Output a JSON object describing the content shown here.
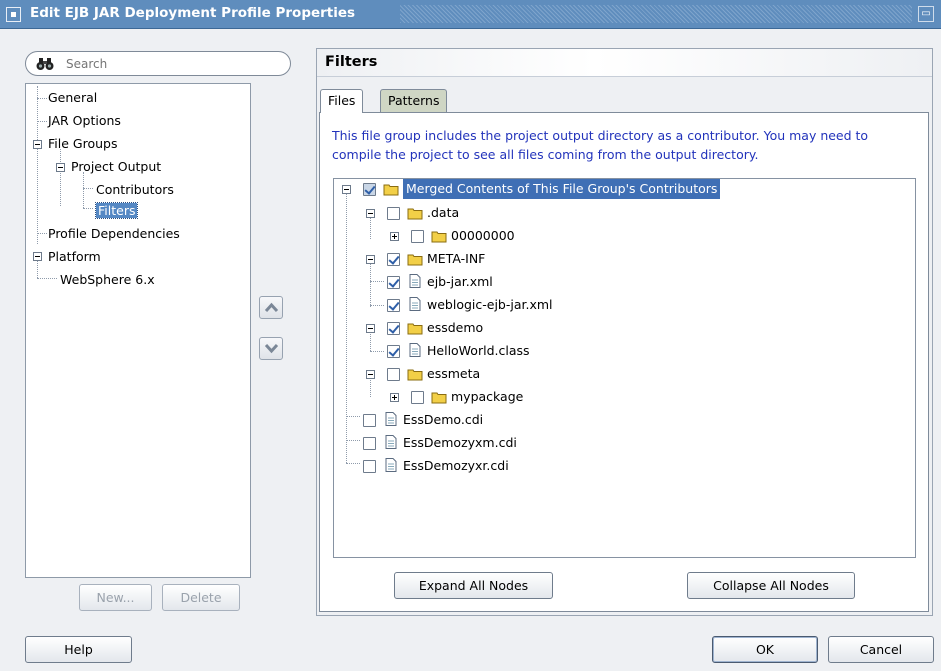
{
  "window": {
    "title": "Edit EJB JAR Deployment Profile Properties"
  },
  "search": {
    "placeholder": "Search"
  },
  "nav": {
    "items": [
      {
        "label": "General"
      },
      {
        "label": "JAR Options"
      },
      {
        "label": "File Groups"
      },
      {
        "label": "Project Output"
      },
      {
        "label": "Contributors"
      },
      {
        "label": "Filters"
      },
      {
        "label": "Profile Dependencies"
      },
      {
        "label": "Platform"
      },
      {
        "label": "WebSphere 6.x"
      }
    ],
    "selected": "Filters"
  },
  "left_buttons": {
    "new_label": "New...",
    "delete_label": "Delete"
  },
  "panel": {
    "heading": "Filters",
    "tabs": [
      {
        "label": "Files",
        "active": true
      },
      {
        "label": "Patterns",
        "active": false
      }
    ],
    "info": "This file group includes the project output directory as a contributor.  You may need to compile the project to see all files coming from the output directory."
  },
  "file_tree": {
    "nodes": [
      {
        "label": "Merged Contents of This File Group's Contributors",
        "type": "folder",
        "checked": true,
        "selected": true
      },
      {
        "label": ".data",
        "type": "folder",
        "checked": false
      },
      {
        "label": "00000000",
        "type": "folder",
        "checked": false
      },
      {
        "label": "META-INF",
        "type": "folder",
        "checked": true
      },
      {
        "label": "ejb-jar.xml",
        "type": "file",
        "checked": true
      },
      {
        "label": "weblogic-ejb-jar.xml",
        "type": "file",
        "checked": true
      },
      {
        "label": "essdemo",
        "type": "folder",
        "checked": true
      },
      {
        "label": "HelloWorld.class",
        "type": "file",
        "checked": true
      },
      {
        "label": "essmeta",
        "type": "folder",
        "checked": false
      },
      {
        "label": "mypackage",
        "type": "folder",
        "checked": false
      },
      {
        "label": "EssDemo.cdi",
        "type": "file",
        "checked": false
      },
      {
        "label": "EssDemozyxm.cdi",
        "type": "file",
        "checked": false
      },
      {
        "label": "EssDemozyxr.cdi",
        "type": "file",
        "checked": false
      }
    ]
  },
  "tree_buttons": {
    "expand_label": "Expand All Nodes",
    "collapse_label": "Collapse All Nodes"
  },
  "footer": {
    "help_label": "Help",
    "ok_label": "OK",
    "cancel_label": "Cancel"
  },
  "colors": {
    "titlebar": "#5f8dbd",
    "selection": "#3f6fb5",
    "info_text": "#2233bb",
    "inactive_tab": "#cfd6c4"
  }
}
